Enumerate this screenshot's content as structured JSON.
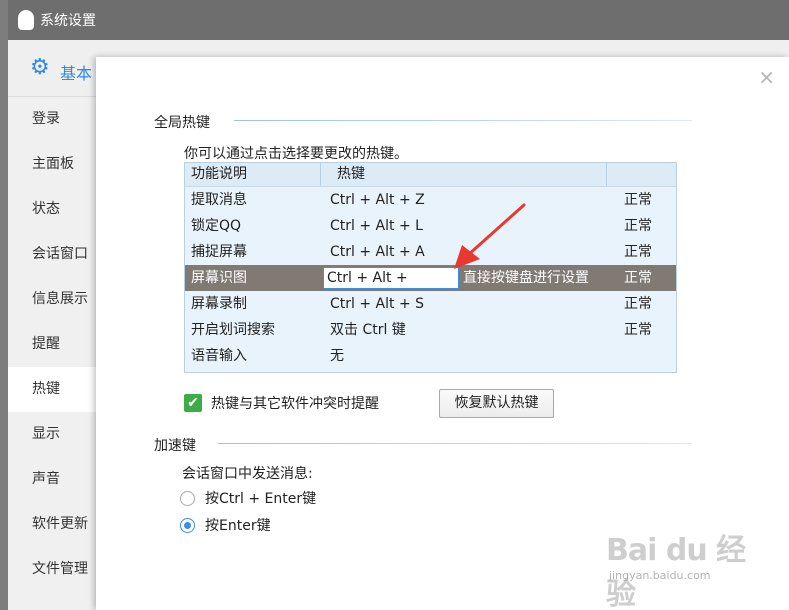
{
  "window": {
    "title": "系统设置"
  },
  "header": {
    "label": "基本"
  },
  "sidebar": {
    "items": [
      {
        "label": "登录"
      },
      {
        "label": "主面板"
      },
      {
        "label": "状态"
      },
      {
        "label": "会话窗口"
      },
      {
        "label": "信息展示"
      },
      {
        "label": "提醒"
      },
      {
        "label": "热键"
      },
      {
        "label": "显示"
      },
      {
        "label": "声音"
      },
      {
        "label": "软件更新"
      },
      {
        "label": "文件管理"
      }
    ],
    "active": "热键"
  },
  "dialog": {
    "close_label": "×",
    "global_hotkeys": {
      "title": "全局热键",
      "hint": "你可以通过点击选择要更改的热键。",
      "columns": [
        "功能说明",
        "热键",
        ""
      ],
      "rows": [
        {
          "function": "提取消息",
          "hotkey": "Ctrl + Alt + Z",
          "status": "正常"
        },
        {
          "function": "锁定QQ",
          "hotkey": "Ctrl + Alt + L",
          "status": "正常"
        },
        {
          "function": "捕捉屏幕",
          "hotkey": "Ctrl + Alt + A",
          "status": "正常"
        },
        {
          "function": "屏幕识图",
          "hotkey": "Ctrl + Alt + ",
          "edit_hint": "直接按键盘进行设置",
          "status": "正常"
        },
        {
          "function": "屏幕录制",
          "hotkey": "Ctrl + Alt + S",
          "status": "正常"
        },
        {
          "function": "开启划词搜索",
          "hotkey": "双击 Ctrl 键",
          "status": "正常"
        },
        {
          "function": "语音输入",
          "hotkey": "无",
          "status": ""
        }
      ],
      "conflict_checkbox": {
        "label": "热键与其它软件冲突时提醒",
        "checked": true
      },
      "restore_button": "恢复默认热键"
    },
    "accelerator": {
      "title": "加速键",
      "send_label": "会话窗口中发送消息:",
      "options": [
        {
          "label": "按Ctrl + Enter键",
          "selected": false
        },
        {
          "label": "按Enter键",
          "selected": true
        }
      ]
    }
  },
  "watermark": {
    "main": "Bai du 经验",
    "sub": "jingyan.baidu.com"
  },
  "colors": {
    "accent": "#3a8ee6",
    "selected_row": "#807a75",
    "check_green": "#3dab47",
    "arrow_red": "#e8382f"
  }
}
